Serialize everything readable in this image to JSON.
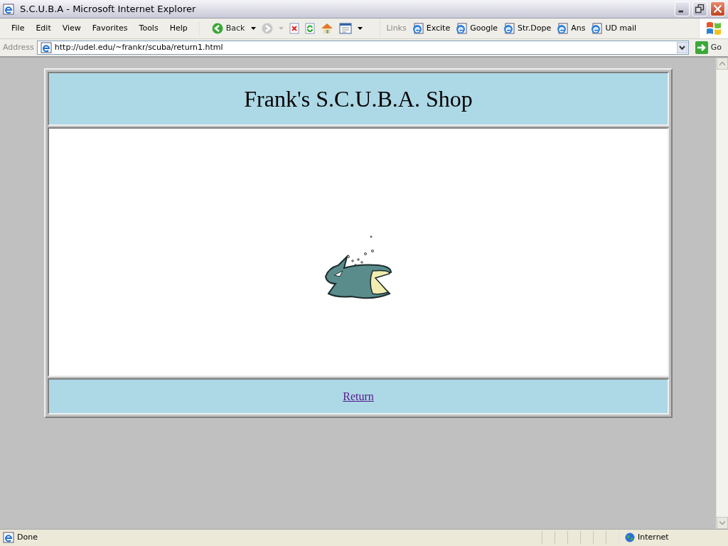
{
  "window": {
    "title": "S.C.U.B.A - Microsoft Internet Explorer"
  },
  "menu": [
    "File",
    "Edit",
    "View",
    "Favorites",
    "Tools",
    "Help"
  ],
  "toolbar": {
    "back_label": "Back"
  },
  "links": {
    "label": "Links",
    "items": [
      "Excite",
      "Google",
      "Str.Dope",
      "Ans",
      "UD mail"
    ]
  },
  "address": {
    "label": "Address",
    "url": "http://udel.edu/~frankr/scuba/return1.html",
    "go_label": "Go"
  },
  "page": {
    "heading": "Frank's S.C.U.B.A. Shop",
    "link": "Return"
  },
  "status_bar": {
    "text": "Done",
    "zone": "Internet"
  }
}
